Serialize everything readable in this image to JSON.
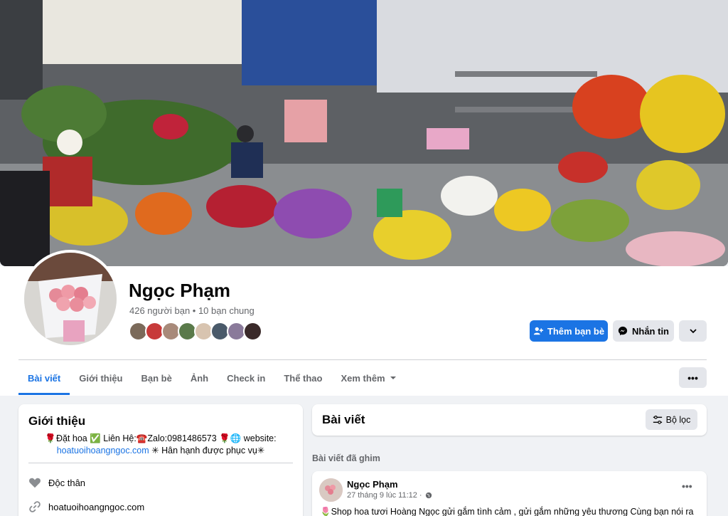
{
  "profile": {
    "name": "Ngọc Phạm",
    "friends_line": "426 người bạn • 10 bạn chung",
    "mutual_count": 8
  },
  "actions": {
    "add_friend": "Thêm bạn bè",
    "message": "Nhắn tin"
  },
  "tabs": [
    "Bài viết",
    "Giới thiệu",
    "Bạn bè",
    "Ảnh",
    "Check in",
    "Thể thao",
    "Xem thêm"
  ],
  "intro": {
    "title": "Giới thiệu",
    "bio_line1": "🌹Đặt hoa ✅ Liên Hệ:☎️Zalo:0981486573 🌹🌐 website:",
    "bio_link": "hoatuoihoangngoc.com",
    "bio_line2_rest": " ✳ Hân hạnh được phục vụ✳",
    "relationship": "Độc thân",
    "website": "hoatuoihoangngoc.com"
  },
  "posts": {
    "title": "Bài viết",
    "filter_label": "Bộ lọc",
    "pinned_label": "Bài viết đã ghim",
    "pinned_post": {
      "author": "Ngọc Phạm",
      "time": "27 tháng 9 lúc 11:12 ·",
      "text": "🌷Shop hoa tươi Hoàng Ngọc gửi gắm tình cảm , gửi gắm những yêu thương Cùng bạn nói ra"
    }
  },
  "colors": {
    "accent": "#1b74e4",
    "secondary_button": "#e4e6eb",
    "page_bg": "#f0f2f5"
  }
}
